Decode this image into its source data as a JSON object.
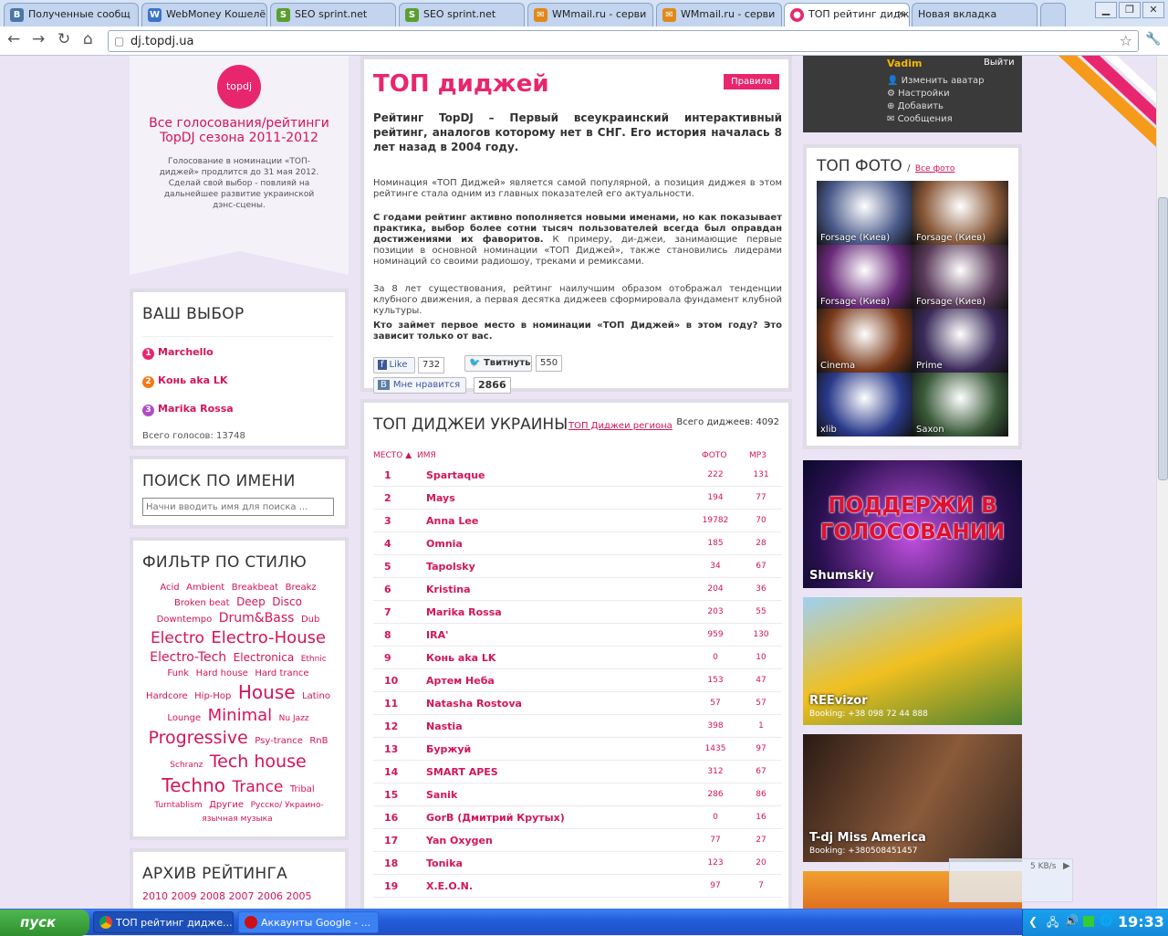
{
  "browser": {
    "tabs": [
      {
        "label": "Полученные сообщ",
        "icon": "B",
        "color": "#4a76a8"
      },
      {
        "label": "WebMoney Кошелё",
        "icon": "W",
        "color": "#3a74c8"
      },
      {
        "label": "SEO sprint.net",
        "icon": "S",
        "color": "#5a9e2f"
      },
      {
        "label": "SEO sprint.net",
        "icon": "S",
        "color": "#5a9e2f"
      },
      {
        "label": "WMmail.ru - серви",
        "icon": "✉",
        "color": "#e0891a"
      },
      {
        "label": "WMmail.ru - серви",
        "icon": "✉",
        "color": "#e0891a"
      },
      {
        "label": "ТОП рейтинг диджей",
        "icon": "●",
        "color": "#e8266e"
      },
      {
        "label": "Новая вкладка",
        "icon": "",
        "color": ""
      }
    ],
    "url": "dj.topdj.ua"
  },
  "promo": {
    "logo": "topdj",
    "title": "Все голосования/рейтинги TopDJ сезона 2011-2012",
    "text": "Голосование в номинации «ТОП-диджей» продлится до 31 мая 2012. Сделай свой выбор - повлияй на дальнейшее развитие украинской дэнс-сцены."
  },
  "choice": {
    "title": "ВАШ ВЫБОР",
    "items": [
      {
        "n": "1",
        "name": "Marchello",
        "color": "#e8266e"
      },
      {
        "n": "2",
        "name": "Конь aka LK",
        "color": "#f07a1a"
      },
      {
        "n": "3",
        "name": "Marika Rossa",
        "color": "#b04cc8"
      }
    ],
    "total": "Всего голосов: 13748"
  },
  "search": {
    "title": "ПОИСК ПО ИМЕНИ",
    "placeholder": "Начни вводить имя для поиска ..."
  },
  "filter": {
    "title": "ФИЛЬТР ПО СТИЛЮ",
    "tags": [
      {
        "t": "Acid",
        "s": 10
      },
      {
        "t": "Ambient",
        "s": 10
      },
      {
        "t": "Breakbeat",
        "s": 10
      },
      {
        "t": "Breakz",
        "s": 10
      },
      {
        "t": "Broken beat",
        "s": 10
      },
      {
        "t": "Deep",
        "s": 12
      },
      {
        "t": "Disco",
        "s": 12
      },
      {
        "t": "Downtempo",
        "s": 10
      },
      {
        "t": "Drum&Bass",
        "s": 14
      },
      {
        "t": "Dub",
        "s": 10
      },
      {
        "t": "Electro",
        "s": 17
      },
      {
        "t": "Electro-House",
        "s": 18
      },
      {
        "t": "Electro-Tech",
        "s": 14
      },
      {
        "t": "Electronica",
        "s": 12
      },
      {
        "t": "Ethnic",
        "s": 9
      },
      {
        "t": "Funk",
        "s": 10
      },
      {
        "t": "Hard house",
        "s": 10
      },
      {
        "t": "Hard trance",
        "s": 10
      },
      {
        "t": "Hardcore",
        "s": 10
      },
      {
        "t": "Hip-Hop",
        "s": 10
      },
      {
        "t": "House",
        "s": 20
      },
      {
        "t": "Latino",
        "s": 10
      },
      {
        "t": "Lounge",
        "s": 10
      },
      {
        "t": "Minimal",
        "s": 18
      },
      {
        "t": "Nu Jazz",
        "s": 9
      },
      {
        "t": "Progressive",
        "s": 19
      },
      {
        "t": "Psy-trance",
        "s": 10
      },
      {
        "t": "RnB",
        "s": 10
      },
      {
        "t": "Schranz",
        "s": 9
      },
      {
        "t": "Tech house",
        "s": 19
      },
      {
        "t": "Techno",
        "s": 20
      },
      {
        "t": "Trance",
        "s": 17
      },
      {
        "t": "Tribal",
        "s": 10
      },
      {
        "t": "Turntablism",
        "s": 9
      },
      {
        "t": "Другие",
        "s": 10
      },
      {
        "t": "Русско/ Украино-язычная музыка",
        "s": 9
      }
    ]
  },
  "archive": {
    "title": "АРХИВ РЕЙТИНГА",
    "years": "2010 2009 2008 2007 2006 2005"
  },
  "intro": {
    "title": "ТОП диджей",
    "rules": "Правила",
    "lead": "Рейтинг TopDJ – Первый всеукраинский интерактивный рейтинг, аналогов которому нет в СНГ. Его история началась 8 лет назад в 2004 году.",
    "p1": "Номинация «ТОП Диджей» является самой популярной, а позиция диджея в этом рейтинге стала одним из главных показателей его актуальности.",
    "p2b": "С годами рейтинг активно пополняется новыми именами, но как показывает практика, выбор более сотни тысяч пользователей всегда был оправдан достижениями их фаворитов.",
    "p2": " К примеру, ди-джеи, занимающие первые позиции в основной номинации «ТОП Диджей», также становились лидерами номинаций со своими радиошоу, треками и ремиксами.",
    "p3": "За 8 лет существования, рейтинг наилучшим образом отображал тенденции клубного движения, а первая десятка диджеев сформировала фундамент клубной культуры.",
    "p4": "Кто займет первое место в номинации «ТОП Диджей» в этом году? Это зависит только от вас.",
    "like": "Like",
    "like_count": "732",
    "tweet": "Твитнуть",
    "tweet_count": "550",
    "vk": "Мне нравится",
    "vk_count": "2866"
  },
  "rating": {
    "title": "ТОП ДИДЖЕИ УКРАИНЫ",
    "sub": "ТОП Диджеи региона",
    "total": "Всего диджеев: 4092",
    "cols": {
      "place": "МЕСТО",
      "name": "ИМЯ",
      "photo": "ФОТО",
      "mp3": "MP3"
    },
    "rows": [
      {
        "r": "1",
        "n": "Spartaque",
        "p": "222",
        "m": "131"
      },
      {
        "r": "2",
        "n": "Mays",
        "p": "194",
        "m": "77"
      },
      {
        "r": "3",
        "n": "Anna Lee",
        "p": "19782",
        "m": "70"
      },
      {
        "r": "4",
        "n": "Omnia",
        "p": "185",
        "m": "28"
      },
      {
        "r": "5",
        "n": "Tapolsky",
        "p": "34",
        "m": "67"
      },
      {
        "r": "6",
        "n": "Kristina",
        "p": "204",
        "m": "36"
      },
      {
        "r": "7",
        "n": "Marika Rossa",
        "p": "203",
        "m": "55"
      },
      {
        "r": "8",
        "n": "IRA'",
        "p": "959",
        "m": "130"
      },
      {
        "r": "9",
        "n": "Конь aka LK",
        "p": "0",
        "m": "10"
      },
      {
        "r": "10",
        "n": "Артем Неба",
        "p": "153",
        "m": "47"
      },
      {
        "r": "11",
        "n": "Natasha Rostova",
        "p": "57",
        "m": "57"
      },
      {
        "r": "12",
        "n": "Nastia",
        "p": "398",
        "m": "1"
      },
      {
        "r": "13",
        "n": "Буржуй",
        "p": "1435",
        "m": "97"
      },
      {
        "r": "14",
        "n": "SMART APES",
        "p": "312",
        "m": "67"
      },
      {
        "r": "15",
        "n": "Sanik",
        "p": "286",
        "m": "86"
      },
      {
        "r": "16",
        "n": "GorB (Дмитрий Крутых)",
        "p": "0",
        "m": "16"
      },
      {
        "r": "17",
        "n": "Yan Oxygen",
        "p": "77",
        "m": "27"
      },
      {
        "r": "18",
        "n": "Tonika",
        "p": "123",
        "m": "20"
      },
      {
        "r": "19",
        "n": "X.E.O.N.",
        "p": "97",
        "m": "7"
      }
    ]
  },
  "user": {
    "name": "Vadim",
    "logout": "Выйти",
    "links": [
      "Изменить аватар",
      "Настройки",
      "Добавить",
      "Сообщения"
    ]
  },
  "photos": {
    "title": "ТОП ФОТО",
    "all": "Все фото",
    "items": [
      {
        "c": "Forsage (Киев)",
        "bg": "#4a5a8a"
      },
      {
        "c": "Forsage (Киев)",
        "bg": "#8a5a3a"
      },
      {
        "c": "Forsage (Киев)",
        "bg": "#6a2a7a"
      },
      {
        "c": "Forsage (Киев)",
        "bg": "#5a3a5a"
      },
      {
        "c": "Cinema",
        "bg": "#7a3a1a"
      },
      {
        "c": "Prime",
        "bg": "#3a2a5a"
      },
      {
        "c": "xlib",
        "bg": "#2a3a8a"
      },
      {
        "c": "Saxon",
        "bg": "#3a5a3a"
      }
    ]
  },
  "banners": [
    {
      "headline": "ПОДДЕРЖИ В ГОЛОСОВАНИИ",
      "name": "Shumskiy",
      "booking": ""
    },
    {
      "headline": "",
      "name": "REEvizor",
      "booking": "Booking: +38 098 72 44 888"
    },
    {
      "headline": "",
      "name": "T-dj Miss America",
      "booking": "Booking: +380508451457"
    }
  ],
  "speed": "5 KB/s",
  "taskbar": {
    "start": "пуск",
    "items": [
      "ТОП рейтинг дидже...",
      "Аккаунты Google - ..."
    ],
    "clock": "19:33"
  }
}
